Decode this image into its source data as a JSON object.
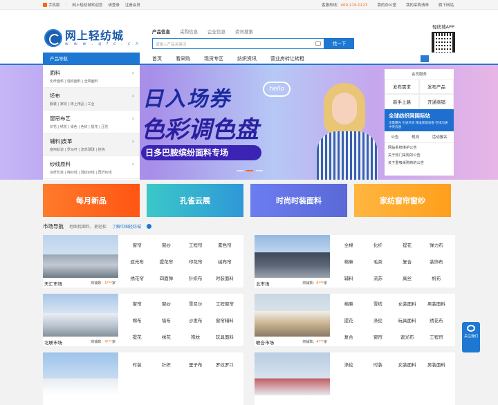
{
  "topbar": {
    "mobile": "手机版",
    "welcome": "网上轻纺城欢迎您",
    "login": "请登录",
    "register": "注册会员",
    "hotline_label": "客服热线：",
    "hotline": "400-119-0123",
    "my_office": "我的办公室",
    "my_purchase": "我的采购清单",
    "sites": "旗下网站"
  },
  "logo": {
    "name": "网上轻纺城",
    "url": "w w w . q f c . c n"
  },
  "search": {
    "tabs": [
      "产品信息",
      "采购信息",
      "企业信息",
      "资讯搜索"
    ],
    "placeholder": "请输入产品关键词",
    "button": "找一下"
  },
  "app": {
    "label": "轻纺城APP"
  },
  "nav": {
    "category": "产品导航",
    "links": [
      "首页",
      "看采购",
      "现货专区",
      "纺织资讯",
      "营业房转让转租"
    ]
  },
  "sidemenu": [
    {
      "title": "面料",
      "subs": "化纤面料 | 混纺面料 | 全棉面料"
    },
    {
      "title": "坯布",
      "subs": "服装 | 家纺 | 床上用品 | 工业"
    },
    {
      "title": "窗帘布艺",
      "subs": "印花 | 绣花 | 染色 | 色织 | 提花 | 压花"
    },
    {
      "title": "辅料|皮革",
      "subs": "窗帘轨道 | 罗马杆 | 流苏球球 | 挂钩"
    },
    {
      "title": "纱线原料",
      "subs": "合纤长丝 | 棉纱线 | 混纺纱线 | 再纤纱线"
    }
  ],
  "banner": {
    "line1": "日入场券",
    "line2": "色彩调色盘",
    "pill": "日多巴胺缤纷面料专场",
    "hello": "hello"
  },
  "member": {
    "title": "会员服务",
    "grid": [
      "发布需求",
      "发布产品",
      "新手上路",
      "开通商铺"
    ],
    "promo_title": "全球纺织网国际站",
    "promo_sub": "流量曝光 引进外资 精准获取询盘 在线沟通 中央沟通",
    "tabs": [
      "公告",
      "规则",
      "活动报名"
    ],
    "news": [
      "网站系统维护公告",
      "关于热门采购的公告",
      "关于重吸采购商的公告"
    ]
  },
  "cards": [
    "每月新品",
    "孔雀云展",
    "时尚时装面料",
    "家纺窗帘窗纱"
  ],
  "market_head": {
    "title": "市场导航",
    "desc": "地图找面料，更轻松",
    "link": "了解中国轻纺城"
  },
  "markets": [
    {
      "name": "天汇市场",
      "count_label": "商铺数：",
      "count": "1***",
      "unit": "家",
      "tags": [
        "窗帘",
        "窗纱",
        "工程帘",
        "素色帘",
        "遮光布",
        "提花帘",
        "印花帘",
        "绒布帘",
        "绣花帘",
        "四面弹",
        "针织布",
        "时装面料"
      ]
    },
    {
      "name": "北市场",
      "count_label": "商铺数：",
      "count": "6***",
      "unit": "家",
      "tags": [
        "全棉",
        "化纤",
        "提花",
        "弹力布",
        "棉麻",
        "毛类",
        "复合",
        "装饰布",
        "辅料",
        "流苏",
        "真丝",
        "帆布"
      ]
    },
    {
      "name": "北联市场",
      "count_label": "商铺数：",
      "count": "4***",
      "unit": "家",
      "tags": [
        "窗帘",
        "窗纱",
        "雪尼尔",
        "工程窗帘",
        "棉布",
        "墙布",
        "沙发布",
        "窗帘辅料",
        "提花",
        "绣花",
        "抱枕",
        "玩具面料"
      ]
    },
    {
      "name": "联合市场",
      "count_label": "商铺数：",
      "count": "4***",
      "unit": "家",
      "tags": [
        "棉麻",
        "雪纺",
        "女装面料",
        "男装面料",
        "提花",
        "涤纶",
        "玩具面料",
        "绣花布",
        "复合",
        "窗帘",
        "遮光布",
        "工程帘"
      ]
    },
    {
      "name": "",
      "count_label": "",
      "count": "",
      "unit": "",
      "tags": [
        "时装",
        "针织",
        "里子布",
        "罗纹罗口"
      ]
    },
    {
      "name": "",
      "count_label": "",
      "count": "",
      "unit": "",
      "tags": [
        "涤纶",
        "时装",
        "女装面料",
        "男装面料"
      ]
    }
  ],
  "float": {
    "label": "关注我们"
  }
}
